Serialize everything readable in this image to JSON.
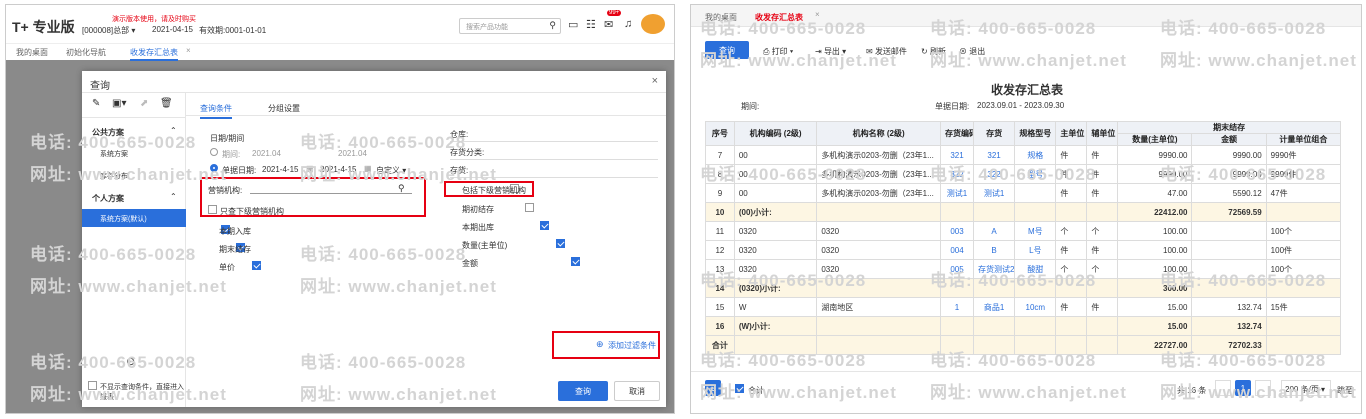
{
  "left": {
    "brand": "T+ 专业版",
    "demo_notice": "演示版本使用，请及时购买",
    "company": "[000008]总部",
    "login_date": "2021-04-15",
    "valid_until": "有效期:0001-01-01",
    "search_placeholder": "搜索产品功能",
    "badge": "99+",
    "tabs": [
      "我的桌面",
      "初始化导航",
      "收发存汇总表"
    ],
    "dialog": {
      "title": "查询",
      "public_scheme": "公共方案",
      "public_items": [
        "系统方案",
        "库存分布"
      ],
      "personal_scheme": "个人方案",
      "personal_items": [
        "系统方案(默认)"
      ],
      "tabs": [
        "查询条件",
        "分组设置"
      ],
      "date_label": "日期/期间",
      "period_label": "期间:",
      "period_from": "2021.04",
      "period_to": "2021.04",
      "docdate_label": "单据日期:",
      "docdate_from": "2021-4-15",
      "docdate_to": "2021-4-15",
      "custom": "自定义",
      "org_label": "营销机构:",
      "only_sub_org": "只查下级营销机构",
      "warehouse": "仓库:",
      "inv_class": "存货分类:",
      "inventory": "存货:",
      "include_sub_org": "包括下级营销机构",
      "checks_left": [
        "本期入库",
        "期末结存",
        "单价"
      ],
      "checks_right": [
        "期初结存",
        "本期出库",
        "数量(主单位)",
        "金额"
      ],
      "add_filter": "添加过滤条件",
      "no_show": "不显示查询条件，直接进入报表",
      "query": "查询",
      "cancel": "取消"
    }
  },
  "watermarks": {
    "phone": "电话: 400-665-0028",
    "site": "网址: www.chanjet.net"
  },
  "right": {
    "tabs": [
      "我的桌面",
      "收发存汇总表"
    ],
    "toolbar": {
      "query": "查询",
      "print": "打印",
      "export": "导出",
      "email": "发送邮件",
      "refresh": "刷新",
      "exit": "退出"
    },
    "title": "收发存汇总表",
    "period_label": "期间:",
    "docdate_label": "单据日期:",
    "docdate_value": "2023.09.01 - 2023.09.30",
    "headers": {
      "seq": "序号",
      "org_code": "机构编码 (2级)",
      "org_name": "机构名称 (2级)",
      "inv_code": "存货编码",
      "inv": "存货",
      "spec": "规格型号",
      "main_unit": "主单位",
      "aux_unit": "辅单位",
      "ending": "期末结存",
      "qty": "数量(主单位)",
      "amount": "金额",
      "unit_combo": "计量单位组合"
    },
    "rows": [
      {
        "seq": "7",
        "oc": "00",
        "on": "多机构演示0203-勿删（23年1...",
        "ic": "321",
        "inv": "321",
        "spec": "规格",
        "mu": "件",
        "au": "件",
        "qty": "9990.00",
        "amt": "9990.00",
        "uc": "9990件",
        "sub": false
      },
      {
        "seq": "8",
        "oc": "00",
        "on": "多机构演示0203-勿删（23年1...",
        "ic": "322",
        "inv": "322",
        "spec": "型号",
        "mu": "件",
        "au": "件",
        "qty": "9999.00",
        "amt": "9999.00",
        "uc": "9999件",
        "sub": false
      },
      {
        "seq": "9",
        "oc": "00",
        "on": "多机构演示0203-勿删（23年1...",
        "ic": "测试1",
        "inv": "测试1",
        "spec": "",
        "mu": "件",
        "au": "件",
        "qty": "47.00",
        "amt": "5590.12",
        "uc": "47件",
        "sub": false
      },
      {
        "seq": "10",
        "oc": "(00)小计:",
        "on": "",
        "ic": "",
        "inv": "",
        "spec": "",
        "mu": "",
        "au": "",
        "qty": "22412.00",
        "amt": "72569.59",
        "uc": "",
        "sub": true
      },
      {
        "seq": "11",
        "oc": "0320",
        "on": "0320",
        "ic": "003",
        "inv": "A",
        "spec": "M号",
        "mu": "个",
        "au": "个",
        "qty": "100.00",
        "amt": "",
        "uc": "100个",
        "sub": false
      },
      {
        "seq": "12",
        "oc": "0320",
        "on": "0320",
        "ic": "004",
        "inv": "B",
        "spec": "L号",
        "mu": "件",
        "au": "件",
        "qty": "100.00",
        "amt": "",
        "uc": "100件",
        "sub": false
      },
      {
        "seq": "13",
        "oc": "0320",
        "on": "0320",
        "ic": "005",
        "inv": "存货测试2",
        "spec": "酸甜",
        "mu": "个",
        "au": "个",
        "qty": "100.00",
        "amt": "",
        "uc": "100个",
        "sub": false
      },
      {
        "seq": "14",
        "oc": "(0320)小计:",
        "on": "",
        "ic": "",
        "inv": "",
        "spec": "",
        "mu": "",
        "au": "",
        "qty": "300.00",
        "amt": "",
        "uc": "",
        "sub": true
      },
      {
        "seq": "15",
        "oc": "W",
        "on": "湖南地区",
        "ic": "1",
        "inv": "商品1",
        "spec": "10cm",
        "mu": "件",
        "au": "件",
        "qty": "15.00",
        "amt": "132.74",
        "uc": "15件",
        "sub": false
      },
      {
        "seq": "16",
        "oc": "(W)小计:",
        "on": "",
        "ic": "",
        "inv": "",
        "spec": "",
        "mu": "",
        "au": "",
        "qty": "15.00",
        "amt": "132.74",
        "uc": "",
        "sub": true
      },
      {
        "seq": "合计",
        "oc": "",
        "on": "",
        "ic": "",
        "inv": "",
        "spec": "",
        "mu": "",
        "au": "",
        "qty": "22727.00",
        "amt": "72702.33",
        "uc": "",
        "sub": true
      }
    ],
    "footer": {
      "total_check": "合计",
      "count": "共 16 条",
      "page": "1",
      "page_size": "200 条/页",
      "jump": "跳至"
    }
  }
}
